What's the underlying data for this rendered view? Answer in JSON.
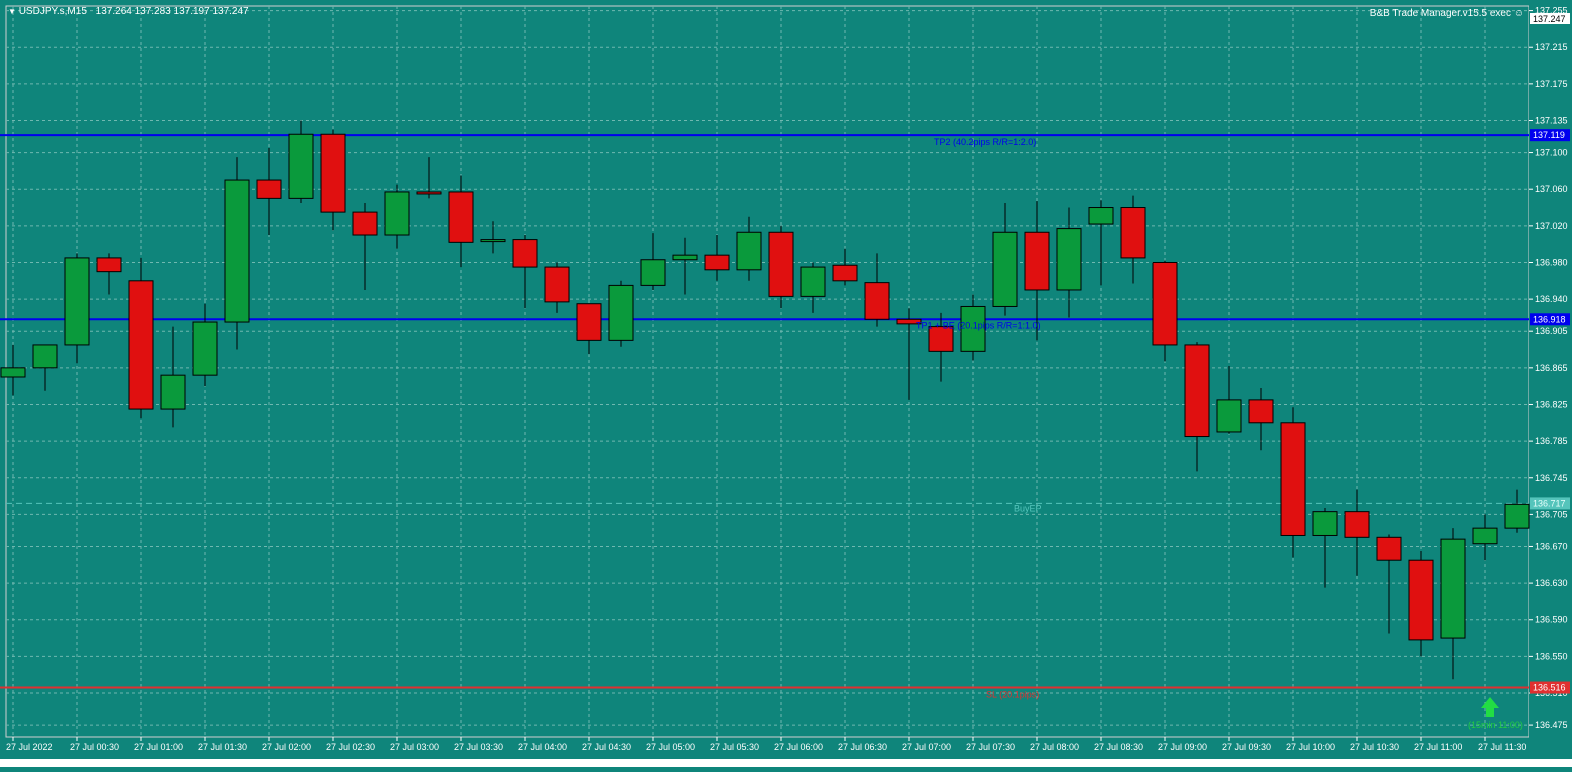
{
  "header": {
    "symbol_info": "USDJPY.s,M15",
    "ohlc": "137.264 137.283 137.197 137.247",
    "ea_label": "B&B Trade Manager.v15.5 exec"
  },
  "colors": {
    "background": "#0f857b",
    "grid": "#6fb8b0",
    "bull": "#0a9a3c",
    "bear": "#e01010",
    "tp_line": "#0000ee",
    "sl_line": "#e03030",
    "entry_line": "#55c4bb",
    "axis_text": "#ffffff"
  },
  "levels": {
    "tp2": {
      "price": 137.119,
      "tag": "137.119",
      "label": "TP2 (40.2pips R/R=1:2.0)"
    },
    "tp1": {
      "price": 136.918,
      "tag": "136.918",
      "label": "TP1 + BE (20.1pips R/R=1:1.0)"
    },
    "entry": {
      "price": 136.717,
      "tag": "136.717",
      "label": "BuyEP"
    },
    "sl": {
      "price": 136.516,
      "tag": "136.516",
      "label": "SL (20.1pips)"
    }
  },
  "signal": {
    "label": "(15min 11:00)",
    "icon": "green-up-arrow-icon"
  },
  "chart_data": {
    "type": "candlestick",
    "symbol": "USDJPY.s",
    "timeframe": "M15",
    "ylim": [
      136.462,
      137.26
    ],
    "y_ticks": [
      "137.255",
      "137.215",
      "137.175",
      "137.135",
      "137.100",
      "137.060",
      "137.020",
      "136.980",
      "136.940",
      "136.905",
      "136.865",
      "136.825",
      "136.785",
      "136.745",
      "136.705",
      "136.670",
      "136.630",
      "136.590",
      "136.550",
      "136.510",
      "136.475"
    ],
    "top_price_tag": "137.247",
    "x_ticks": [
      "27 Jul 2022",
      "27 Jul 00:30",
      "27 Jul 01:00",
      "27 Jul 01:30",
      "27 Jul 02:00",
      "27 Jul 02:30",
      "27 Jul 03:00",
      "27 Jul 03:30",
      "27 Jul 04:00",
      "27 Jul 04:30",
      "27 Jul 05:00",
      "27 Jul 05:30",
      "27 Jul 06:00",
      "27 Jul 06:30",
      "27 Jul 07:00",
      "27 Jul 07:30",
      "27 Jul 08:00",
      "27 Jul 08:30",
      "27 Jul 09:00",
      "27 Jul 09:30",
      "27 Jul 10:00",
      "27 Jul 10:30",
      "27 Jul 11:00",
      "27 Jul 11:30"
    ],
    "candles": [
      {
        "o": 136.855,
        "h": 136.89,
        "l": 136.835,
        "c": 136.865
      },
      {
        "o": 136.865,
        "h": 136.885,
        "l": 136.84,
        "c": 136.89
      },
      {
        "o": 136.89,
        "h": 136.99,
        "l": 136.87,
        "c": 136.985
      },
      {
        "o": 136.985,
        "h": 136.99,
        "l": 136.945,
        "c": 136.97
      },
      {
        "o": 136.96,
        "h": 136.985,
        "l": 136.81,
        "c": 136.82
      },
      {
        "o": 136.82,
        "h": 136.91,
        "l": 136.8,
        "c": 136.857
      },
      {
        "o": 136.857,
        "h": 136.935,
        "l": 136.845,
        "c": 136.915
      },
      {
        "o": 136.915,
        "h": 137.095,
        "l": 136.885,
        "c": 137.07
      },
      {
        "o": 137.07,
        "h": 137.105,
        "l": 137.01,
        "c": 137.05
      },
      {
        "o": 137.05,
        "h": 137.135,
        "l": 137.045,
        "c": 137.12
      },
      {
        "o": 137.12,
        "h": 137.125,
        "l": 137.015,
        "c": 137.035
      },
      {
        "o": 137.035,
        "h": 137.045,
        "l": 136.95,
        "c": 137.01
      },
      {
        "o": 137.01,
        "h": 137.065,
        "l": 136.995,
        "c": 137.057
      },
      {
        "o": 137.057,
        "h": 137.095,
        "l": 137.05,
        "c": 137.055
      },
      {
        "o": 137.057,
        "h": 137.075,
        "l": 136.975,
        "c": 137.002
      },
      {
        "o": 137.005,
        "h": 137.025,
        "l": 136.99,
        "c": 137.005
      },
      {
        "o": 137.005,
        "h": 137.01,
        "l": 136.93,
        "c": 136.975
      },
      {
        "o": 136.975,
        "h": 136.98,
        "l": 136.925,
        "c": 136.937
      },
      {
        "o": 136.935,
        "h": 136.935,
        "l": 136.88,
        "c": 136.895
      },
      {
        "o": 136.895,
        "h": 136.96,
        "l": 136.888,
        "c": 136.955
      },
      {
        "o": 136.955,
        "h": 137.012,
        "l": 136.95,
        "c": 136.983
      },
      {
        "o": 136.983,
        "h": 137.007,
        "l": 136.945,
        "c": 136.988
      },
      {
        "o": 136.988,
        "h": 137.01,
        "l": 136.96,
        "c": 136.972
      },
      {
        "o": 136.972,
        "h": 137.03,
        "l": 136.96,
        "c": 137.013
      },
      {
        "o": 137.013,
        "h": 137.02,
        "l": 136.93,
        "c": 136.943
      },
      {
        "o": 136.943,
        "h": 136.98,
        "l": 136.925,
        "c": 136.975
      },
      {
        "o": 136.977,
        "h": 136.995,
        "l": 136.955,
        "c": 136.96
      },
      {
        "o": 136.958,
        "h": 136.99,
        "l": 136.91,
        "c": 136.918
      },
      {
        "o": 136.918,
        "h": 136.93,
        "l": 136.83,
        "c": 136.913
      },
      {
        "o": 136.91,
        "h": 136.925,
        "l": 136.85,
        "c": 136.883
      },
      {
        "o": 136.883,
        "h": 136.945,
        "l": 136.873,
        "c": 136.932
      },
      {
        "o": 136.932,
        "h": 137.045,
        "l": 136.922,
        "c": 137.013
      },
      {
        "o": 137.013,
        "h": 137.047,
        "l": 136.895,
        "c": 136.95
      },
      {
        "o": 136.95,
        "h": 137.04,
        "l": 136.92,
        "c": 137.017
      },
      {
        "o": 137.022,
        "h": 137.048,
        "l": 136.955,
        "c": 137.04
      },
      {
        "o": 137.04,
        "h": 137.053,
        "l": 136.957,
        "c": 136.985
      },
      {
        "o": 136.98,
        "h": 136.982,
        "l": 136.872,
        "c": 136.89
      },
      {
        "o": 136.89,
        "h": 136.893,
        "l": 136.752,
        "c": 136.79
      },
      {
        "o": 136.795,
        "h": 136.867,
        "l": 136.793,
        "c": 136.83
      },
      {
        "o": 136.83,
        "h": 136.843,
        "l": 136.775,
        "c": 136.805
      },
      {
        "o": 136.805,
        "h": 136.822,
        "l": 136.658,
        "c": 136.682
      },
      {
        "o": 136.682,
        "h": 136.712,
        "l": 136.625,
        "c": 136.708
      },
      {
        "o": 136.708,
        "h": 136.732,
        "l": 136.638,
        "c": 136.68
      },
      {
        "o": 136.68,
        "h": 136.683,
        "l": 136.575,
        "c": 136.655
      },
      {
        "o": 136.655,
        "h": 136.665,
        "l": 136.55,
        "c": 136.568
      },
      {
        "o": 136.57,
        "h": 136.69,
        "l": 136.525,
        "c": 136.678
      },
      {
        "o": 136.673,
        "h": 136.705,
        "l": 136.655,
        "c": 136.69
      },
      {
        "o": 136.69,
        "h": 136.732,
        "l": 136.685,
        "c": 136.716
      }
    ]
  }
}
